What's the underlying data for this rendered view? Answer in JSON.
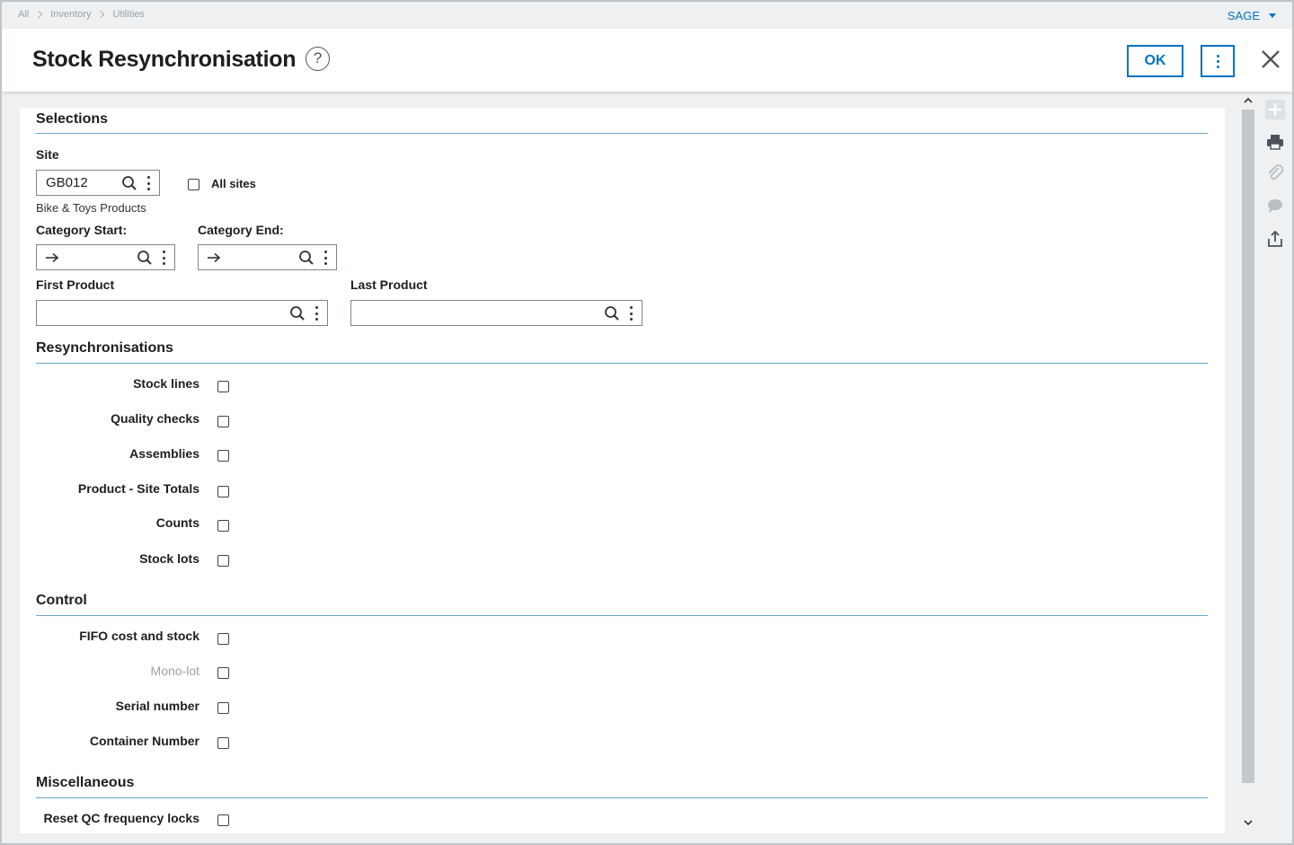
{
  "breadcrumb": [
    "All",
    "Inventory",
    "Utilities"
  ],
  "user_menu": {
    "label": "SAGE"
  },
  "header": {
    "title": "Stock Resynchronisation",
    "ok_label": "OK"
  },
  "selections": {
    "title": "Selections",
    "site_label": "Site",
    "site_value": "GB012",
    "site_description": "Bike & Toys Products",
    "all_sites_label": "All sites",
    "category_start_label": "Category Start:",
    "category_end_label": "Category End:",
    "first_product_label": "First Product",
    "last_product_label": "Last Product"
  },
  "resynchronisations": {
    "title": "Resynchronisations",
    "items": [
      {
        "label": "Stock lines"
      },
      {
        "label": "Quality checks"
      },
      {
        "label": "Assemblies"
      },
      {
        "label": "Product - Site Totals"
      },
      {
        "label": "Counts"
      },
      {
        "label": "Stock lots"
      }
    ]
  },
  "control": {
    "title": "Control",
    "items": [
      {
        "label": "FIFO cost and stock",
        "disabled": false
      },
      {
        "label": "Mono-lot",
        "disabled": true
      },
      {
        "label": "Serial number",
        "disabled": false
      },
      {
        "label": "Container Number",
        "disabled": false
      }
    ]
  },
  "miscellaneous": {
    "title": "Miscellaneous",
    "items": [
      {
        "label": "Reset QC frequency locks"
      }
    ]
  },
  "rail_icons": [
    "plus-icon",
    "print-icon",
    "paperclip-icon",
    "comment-icon",
    "export-icon"
  ],
  "colors": {
    "accent": "#0073c2",
    "section_line": "#6aa7c9",
    "background": "#eef0f2"
  }
}
